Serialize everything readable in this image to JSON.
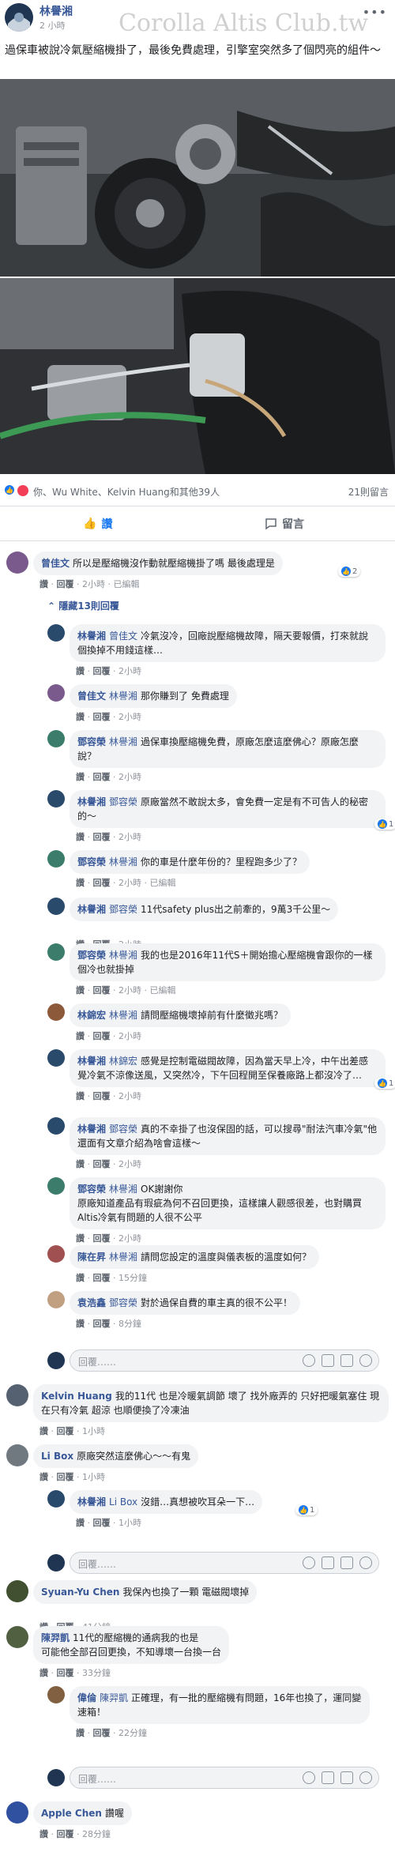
{
  "post": {
    "author": "林譽湘",
    "time": "2 小時",
    "watermark": "Corolla Altis Club.tw",
    "text": "過保車被說冷氣壓縮機掛了，最後免費處理，引擎室突然多了個閃亮的組件～"
  },
  "reactions": {
    "summary": "你、Wu White、Kelvin Huang和其他39人",
    "comments_count": "21則留言"
  },
  "actions": {
    "like": "讚",
    "comment": "留言"
  },
  "labels": {
    "like": "讚",
    "reply": "回覆",
    "edited": "已編輯",
    "dot": "·"
  },
  "collapse_label": "隱藏13則回覆",
  "reply_placeholder": "回覆……",
  "comments": [
    {
      "author": "曾佳文",
      "tag": "",
      "text": "所以是壓縮機沒作動就壓縮機掛了嗎 最後處理是",
      "time": "2小時",
      "edited": true,
      "likes": "2"
    },
    {
      "author": "林譽湘",
      "tag": "曾佳文",
      "text": "冷氣沒冷，回廠說壓縮機故障，隔天要報價，打來就說個換掉不用錢這樣…",
      "time": "2小時",
      "edited": false,
      "likes": ""
    },
    {
      "author": "曾佳文",
      "tag": "林譽湘",
      "text": "那你賺到了 免費處理",
      "time": "2小時",
      "edited": false,
      "likes": ""
    },
    {
      "author": "鄧容榮",
      "tag": "林譽湘",
      "text": "過保車換壓縮機免費，原廠怎麼這麼佛心？原廠怎麼說？",
      "time": "2小時",
      "edited": false,
      "likes": ""
    },
    {
      "author": "林譽湘",
      "tag": "鄧容榮",
      "text": "原廠當然不敢說太多，會免費一定是有不可告人的秘密的～",
      "time": "2小時",
      "edited": false,
      "likes": "1"
    },
    {
      "author": "鄧容榮",
      "tag": "林譽湘",
      "text": "你的車是什麼年份的？里程跑多少了？",
      "time": "2小時",
      "edited": true,
      "likes": ""
    },
    {
      "author": "林譽湘",
      "tag": "鄧容榮",
      "text": "11代safety plus出之前牽的，9萬3千公里～",
      "time": "2小時",
      "edited": false,
      "likes": ""
    },
    {
      "author": "鄧容榮",
      "tag": "林譽湘",
      "text": "我的也是2016年11代S＋開始擔心壓縮機會跟你的一樣個冷也就掛掉",
      "time": "2小時",
      "edited": true,
      "likes": ""
    },
    {
      "author": "林錦宏",
      "tag": "林譽湘",
      "text": "請問壓縮機壞掉前有什麼徵兆嗎？",
      "time": "2小時",
      "edited": false,
      "likes": ""
    },
    {
      "author": "林譽湘",
      "tag": "林錦宏",
      "text": "感覺是控制電磁閥故障，因為當天早上冷，中午出差感覺冷氣不涼像送風，又突然冷，下午回程開至保養廠路上都沒冷了…",
      "time": "2小時",
      "edited": false,
      "likes": "1"
    },
    {
      "author": "林譽湘",
      "tag": "鄧容榮",
      "text": "真的不幸掛了也沒保固的話，可以搜尋\"耐法汽車冷氣\"他還面有文章介紹為啥會這樣～",
      "time": "2小時",
      "edited": false,
      "likes": ""
    },
    {
      "author": "鄧容榮",
      "tag": "林譽湘",
      "text": "OK謝謝你\n原廠知道產品有瑕疵為何不召回更換，這樣讓人觀感很差，也對購買Altis冷氣有問題的人很不公平",
      "time": "2小時",
      "edited": false,
      "likes": ""
    },
    {
      "author": "陳在昇",
      "tag": "林譽湘",
      "text": "請問您設定的溫度與儀表板的溫度如何？",
      "time": "15分鐘",
      "edited": false,
      "likes": ""
    },
    {
      "author": "袁浩鑫",
      "tag": "鄧容榮",
      "text": "對於過保自費的車主真的很不公平！",
      "time": "8分鐘",
      "edited": false,
      "likes": ""
    },
    {
      "author": "Kelvin Huang",
      "tag": "",
      "text": "我的11代 也是冷暖氣調節 壞了 找外廠弄的 只好把暖氣塞住 現在只有冷氣 超涼 也順便換了冷凍油",
      "time": "1小時",
      "edited": false,
      "likes": ""
    },
    {
      "author": "Li Box",
      "tag": "",
      "text": "原廠突然這麼佛心～～有鬼",
      "time": "1小時",
      "edited": false,
      "likes": ""
    },
    {
      "author": "林譽湘",
      "tag": "Li Box",
      "text": "沒錯…真想被吹耳朵一下…",
      "time": "1小時",
      "edited": false,
      "likes": "1"
    },
    {
      "author": "Syuan-Yu Chen",
      "tag": "",
      "text": "我保內也換了一顆 電磁閥壞掉",
      "time": "41分鐘",
      "edited": false,
      "likes": ""
    },
    {
      "author": "陳羿凱",
      "tag": "",
      "text": "11代的壓縮機的通病我的也是\n可能他全部召回更換，不知導壞一台換一台",
      "time": "33分鐘",
      "edited": false,
      "likes": ""
    },
    {
      "author": "偉倫",
      "tag": "陳羿凱",
      "text": "正確理，有一批的壓縮機有問題，16年也換了，運同變速箱！",
      "time": "22分鐘",
      "edited": false,
      "likes": ""
    },
    {
      "author": "Apple Chen",
      "tag": "",
      "text": "讚喔",
      "time": "28分鐘",
      "edited": false,
      "likes": ""
    }
  ],
  "colors": {
    "link": "#385898",
    "bubble": "#f2f3f5",
    "like_blue": "#1877f2"
  },
  "icons": {
    "like": "thumbs-up-icon",
    "comment": "speech-bubble-icon",
    "more": "ellipsis-icon"
  }
}
